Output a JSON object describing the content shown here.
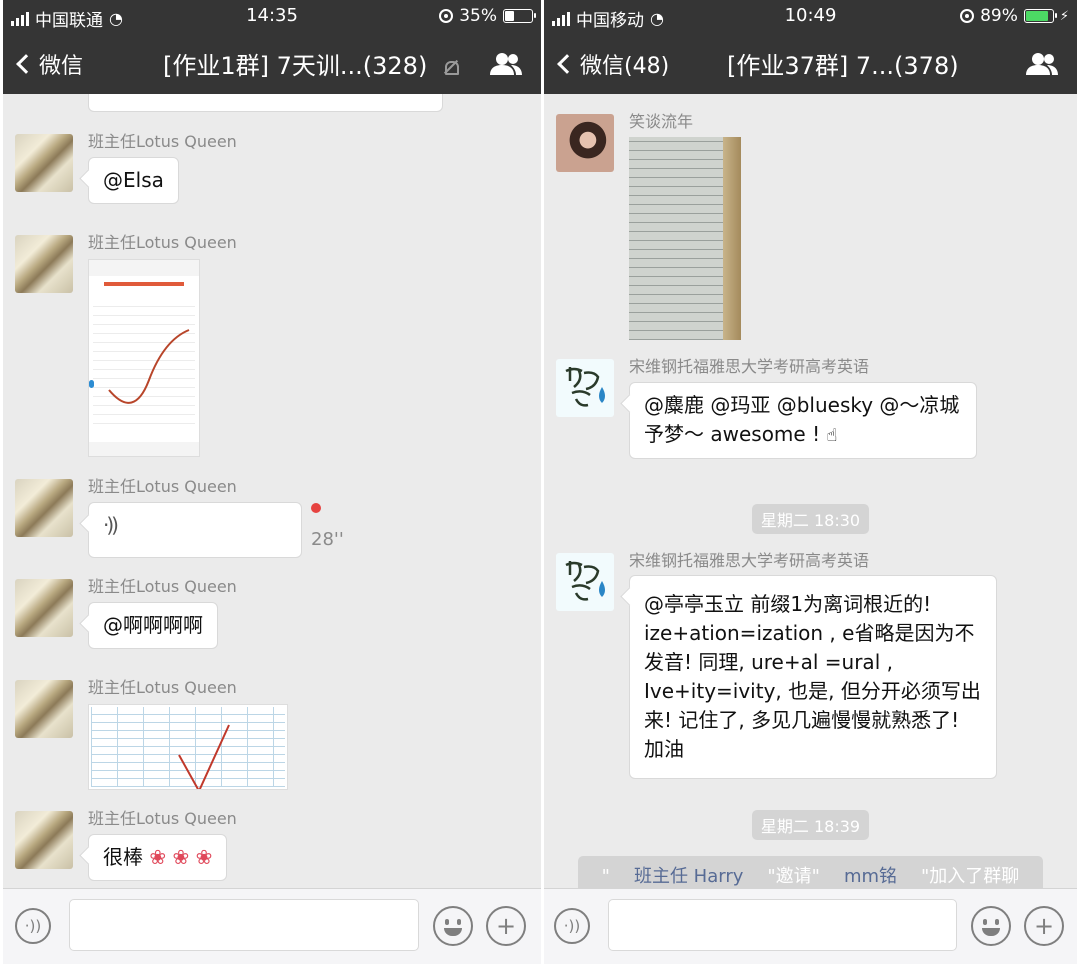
{
  "left": {
    "status": {
      "carrier": "中国联通",
      "time": "14:35",
      "battery": "35%",
      "battery_level": 0.35
    },
    "nav": {
      "back_label": "微信",
      "title": "[作业1群] 7天训...(328)"
    },
    "messages": [
      {
        "sender": "班主任Lotus Queen",
        "text": "@Elsa"
      },
      {
        "sender": "班主任Lotus Queen"
      },
      {
        "sender": "班主任Lotus Queen",
        "voice_duration": "28''"
      },
      {
        "sender": "班主任Lotus Queen",
        "text": "@啊啊啊啊"
      },
      {
        "sender": "班主任Lotus Queen"
      },
      {
        "sender": "班主任Lotus Queen",
        "text": "很棒"
      }
    ]
  },
  "right": {
    "status": {
      "carrier": "中国移动",
      "time": "10:49",
      "battery": "89%",
      "battery_level": 0.89
    },
    "nav": {
      "back_label": "微信(48)",
      "title": "[作业37群] 7...(378)"
    },
    "messages": [
      {
        "sender": "笑谈流年"
      },
      {
        "sender": "宋维钢托福雅思大学考研高考英语",
        "text": "@麋鹿 @玛亚 @bluesky @～凉城予梦～ awesome !"
      },
      {
        "sender": "宋维钢托福雅思大学考研高考英语",
        "text": "@亭亭玉立 前缀1为离词根近的! ize+ation=ization , e省略是因为不发音! 同理, ure+al =ural , Ive+ity=ivity, 也是, 但分开必须写出来! 记住了, 多见几遍慢慢就熟悉了! 加油"
      }
    ],
    "time_separators": [
      "星期二 18:30",
      "星期二 18:39"
    ],
    "system": {
      "q1": "\"",
      "inviter": "班主任 Harry",
      "middle": "\"邀请\"",
      "invitee": "mm铭",
      "suffix": "\"加入了群聊"
    }
  },
  "colors": {
    "nav_bg": "#353535",
    "chat_bg": "#ebebeb",
    "link": "#576b95",
    "unread": "#e64340"
  },
  "icons": [
    "back-chevron-icon",
    "group-icon",
    "mute-icon",
    "voice-icon",
    "emoji-icon",
    "plus-icon",
    "wifi-icon",
    "signal-icon",
    "battery-icon"
  ]
}
